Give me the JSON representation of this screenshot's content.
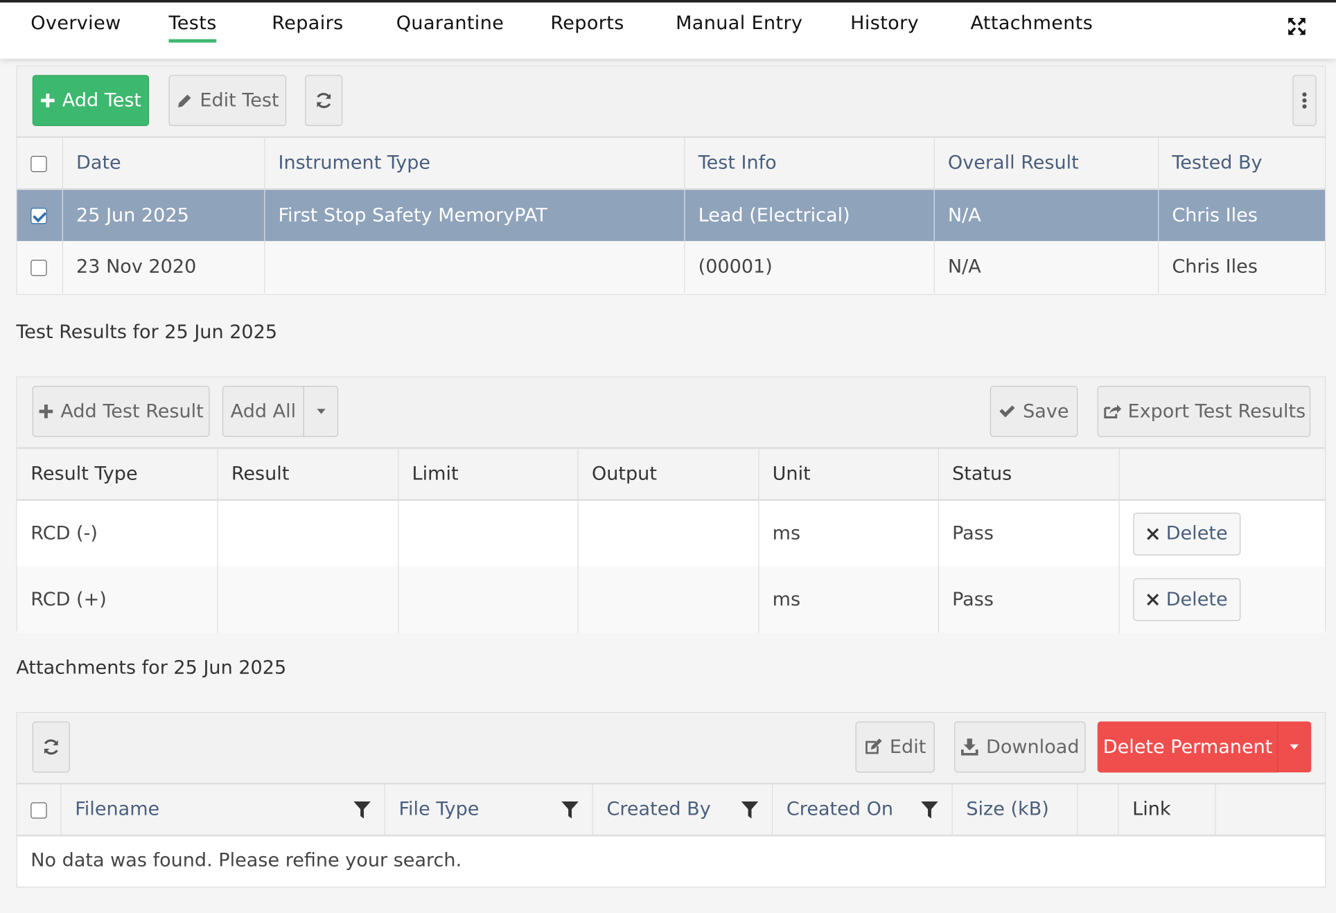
{
  "tabs": [
    {
      "label": "Overview"
    },
    {
      "label": "Tests"
    },
    {
      "label": "Repairs"
    },
    {
      "label": "Quarantine"
    },
    {
      "label": "Reports"
    },
    {
      "label": "Manual Entry"
    },
    {
      "label": "History"
    },
    {
      "label": "Attachments"
    }
  ],
  "active_tab": "Tests",
  "accent_color": "#3fb871",
  "tests_toolbar": {
    "add_test": "Add Test",
    "edit_test": "Edit Test"
  },
  "tests_table": {
    "headers": [
      "Date",
      "Instrument Type",
      "Test Info",
      "Overall Result",
      "Tested By"
    ],
    "rows": [
      {
        "checked": true,
        "date": "25 Jun 2025",
        "instrument_type": "First Stop Safety MemoryPAT",
        "test_info": "Lead (Electrical)",
        "overall_result": "N/A",
        "tested_by": "Chris Iles"
      },
      {
        "checked": false,
        "date": "23 Nov 2020",
        "instrument_type": "",
        "test_info": "(00001)",
        "overall_result": "N/A",
        "tested_by": "Chris Iles"
      }
    ]
  },
  "results_title": "Test Results for 25 Jun 2025",
  "results_toolbar": {
    "add_test_result": "Add Test Result",
    "add_all": "Add All",
    "save": "Save",
    "export": "Export Test Results"
  },
  "results_table": {
    "headers": [
      "Result Type",
      "Result",
      "Limit",
      "Output",
      "Unit",
      "Status",
      ""
    ],
    "rows": [
      {
        "result_type": "RCD (-)",
        "result": "",
        "limit": "",
        "output": "",
        "unit": "ms",
        "status": "Pass",
        "action": "Delete"
      },
      {
        "result_type": "RCD (+)",
        "result": "",
        "limit": "",
        "output": "",
        "unit": "ms",
        "status": "Pass",
        "action": "Delete"
      }
    ]
  },
  "attachments_title": "Attachments for 25 Jun 2025",
  "attachments_toolbar": {
    "edit": "Edit",
    "download": "Download",
    "delete_permanent": "Delete Permanent"
  },
  "attachments_table": {
    "headers": [
      "Filename",
      "File Type",
      "Created By",
      "Created On",
      "Size (kB)",
      "",
      "Link"
    ],
    "empty_message": "No data was found. Please refine your search."
  },
  "icons": [
    "plus-icon",
    "pencil-icon",
    "refresh-icon",
    "kebab-menu-icon",
    "checkmark-icon",
    "export-icon",
    "close-icon",
    "edit-icon",
    "download-icon",
    "caret-down-icon",
    "filter-icon",
    "fullscreen-icon"
  ]
}
